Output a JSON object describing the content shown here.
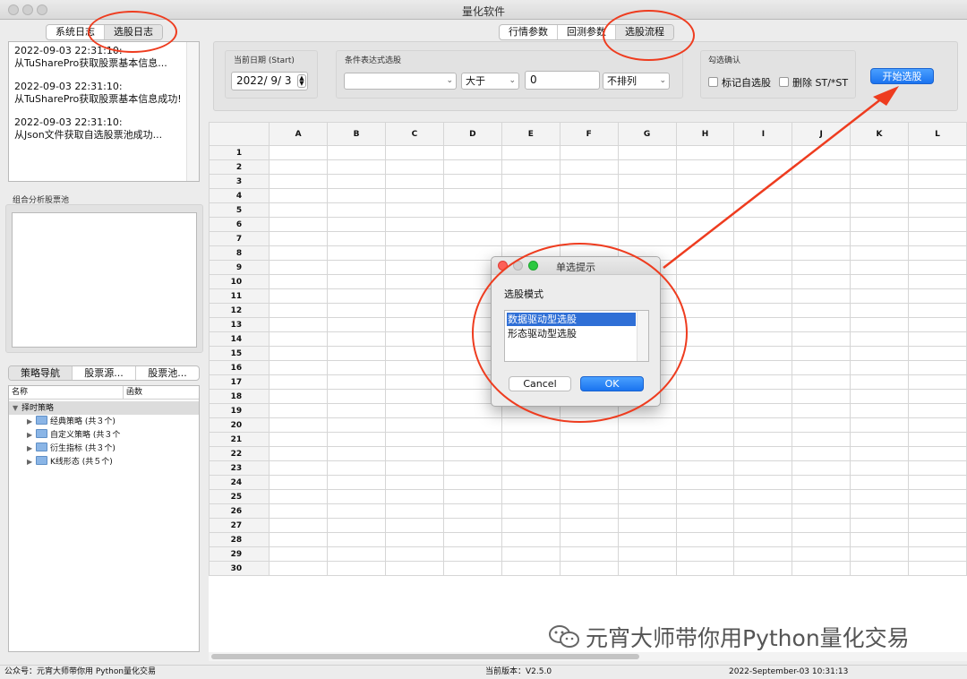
{
  "window": {
    "title": "量化软件"
  },
  "left_tabs": [
    {
      "label": "系统日志"
    },
    {
      "label": "选股日志"
    }
  ],
  "log_entries": [
    {
      "time": "2022-09-03 22:31:10:",
      "message": "从TuSharePro获取股票基本信息..."
    },
    {
      "time": "2022-09-03 22:31:10:",
      "message": "从TuSharePro获取股票基本信息成功!"
    },
    {
      "time": "2022-09-03 22:31:10:",
      "message": "从Json文件获取自选股票池成功..."
    }
  ],
  "pool_label": "组合分析股票池",
  "nav_tabs": [
    {
      "label": "策略导航"
    },
    {
      "label": "股票源..."
    },
    {
      "label": "股票池..."
    }
  ],
  "tree": {
    "headers": {
      "name": "名称",
      "func": "函数"
    },
    "root": "择时策略",
    "children": [
      {
        "label": "经典策略 (共３个)"
      },
      {
        "label": "自定义策略 (共３个"
      },
      {
        "label": "衍生指标 (共３个)"
      },
      {
        "label": "K线形态 (共５个)"
      }
    ]
  },
  "main_tabs": [
    {
      "label": "行情参数"
    },
    {
      "label": "回测参数"
    },
    {
      "label": "选股流程"
    }
  ],
  "date": {
    "label": "当前日期 (Start)",
    "value": "2022/  9/  3"
  },
  "condition": {
    "label": "条件表达式选股",
    "expr_value": "",
    "op_value": "大于",
    "number_value": "0",
    "sort_value": "不排列"
  },
  "confirm": {
    "label": "勾选确认",
    "mark_label": "标记自选股",
    "delete_label": "删除 ST/*ST"
  },
  "start_button": "开始选股",
  "grid": {
    "columns": [
      "A",
      "B",
      "C",
      "D",
      "E",
      "F",
      "G",
      "H",
      "I",
      "J",
      "K",
      "L"
    ],
    "rows": [
      "1",
      "2",
      "3",
      "4",
      "5",
      "6",
      "7",
      "8",
      "9",
      "10",
      "11",
      "12",
      "13",
      "14",
      "15",
      "16",
      "17",
      "18",
      "19",
      "20",
      "21",
      "22",
      "23",
      "24",
      "25",
      "26",
      "27",
      "28",
      "29",
      "30"
    ]
  },
  "dialog": {
    "title": "单选提示",
    "prompt": "选股模式",
    "options": [
      {
        "label": "数据驱动型选股"
      },
      {
        "label": "形态驱动型选股"
      }
    ],
    "cancel": "Cancel",
    "ok": "OK"
  },
  "status": {
    "account": "公众号：元宵大师带你用 Python量化交易",
    "version": "当前版本：V2.5.0",
    "datetime": "2022-September-03 10:31:13"
  },
  "watermark": "元宵大师带你用Python量化交易",
  "colors": {
    "annotation": "#ee3c1f",
    "primary": "#1a73f0",
    "selection": "#2f6fd6"
  }
}
